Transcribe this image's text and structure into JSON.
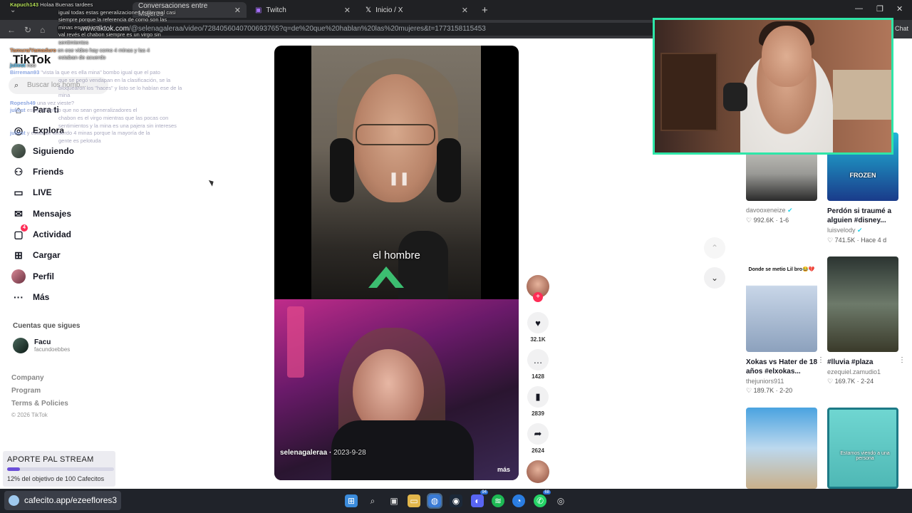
{
  "browser": {
    "tabs": [
      {
        "label": "Conversaciones entre Mujeres"
      },
      {
        "label": "Twitch"
      },
      {
        "label": "Inicio / X"
      }
    ],
    "url_domain": "www.tiktok.com",
    "url_path": "/@selenagaleraa/video/7284056040700693765?q=de%20que%20hablan%20las%20mujeres&t=1773158115453"
  },
  "sidebar": {
    "logo": "TikTok",
    "search_placeholder": "Buscar los homb...",
    "nav": [
      {
        "label": "Para ti",
        "icon": "home-icon"
      },
      {
        "label": "Explora",
        "icon": "compass-icon"
      },
      {
        "label": "Siguiendo",
        "icon": "following-avatar"
      },
      {
        "label": "Friends",
        "icon": "friends-icon"
      },
      {
        "label": "LIVE",
        "icon": "live-icon"
      },
      {
        "label": "Mensajes",
        "icon": "messages-icon"
      },
      {
        "label": "Actividad",
        "icon": "activity-icon",
        "badge": "4"
      },
      {
        "label": "Cargar",
        "icon": "upload-icon"
      },
      {
        "label": "Perfil",
        "icon": "profile-avatar"
      },
      {
        "label": "Más",
        "icon": "more-icon"
      }
    ],
    "following_title": "Cuentas que sigues",
    "following": [
      {
        "name": "Facu",
        "handle": "facundoebbes"
      }
    ],
    "footer": [
      "Company",
      "Program",
      "Terms & Policies"
    ],
    "copyright": "© 2026 TikTok"
  },
  "chat": [
    {
      "user": "Kapuch143",
      "text": "Holaa Buenas tardees"
    },
    {
      "user": "",
      "text": "igual todas estas generalizaciones están mal casi"
    },
    {
      "user": "",
      "text": "siempre porque la referencia de como son las"
    },
    {
      "user": "",
      "text": "minas es noti jota"
    },
    {
      "user": "",
      "text": "val revés el chabon siempre es un virgo sin"
    },
    {
      "user": "",
      "text": "sentimientos"
    },
    {
      "user": "Tamura/Yamaduro",
      "text": "en ese video hay como 4 minas y las 4"
    },
    {
      "user": "",
      "text": "estaban de acuerdo"
    },
    {
      "user": "juliest",
      "text": "noo"
    },
    {
      "user": "Birreman93",
      "text": "\"vista la que es ella mina\" bombo igual que el pato"
    },
    {
      "user": "",
      "text": "que se pegó vendapan en la clasificación, se la"
    },
    {
      "user": "",
      "text": "bloquearon los \"haces\" y listo se lo habían ese de la"
    },
    {
      "user": "",
      "text": "mina"
    },
    {
      "user": "Ropesh49",
      "text": "una vez vieste?"
    },
    {
      "user": "juliest",
      "text": "estoy diciendo que no sean generalizadores el"
    },
    {
      "user": "",
      "text": "chabon es el virgo mientras que las pocas con"
    },
    {
      "user": "",
      "text": "sentimientos y la mina es una pajera sin intereses"
    },
    {
      "user": "juliest",
      "text": "y estas de acuerdo 4 minas porque la mayoría de la"
    },
    {
      "user": "",
      "text": "gente es pelotuda"
    }
  ],
  "video": {
    "subtitle": "el hombre",
    "author": "selenagaleraa",
    "date": "2023-9-28",
    "more": "más"
  },
  "actions": {
    "likes": "32.1K",
    "comments": "1428",
    "saves": "2839",
    "shares": "2624"
  },
  "grid": [
    {
      "title": "",
      "user": "davooxeneize",
      "verified": true,
      "views": "992.6K",
      "date": "1-6"
    },
    {
      "title": "Perdón si traumé a alguien #disney...",
      "user": "luisvelody",
      "verified": true,
      "views": "741.5K",
      "date": "Hace 4 d",
      "thumb_text": "FROZEN"
    },
    {
      "title": "Xokas vs Hater de 18 años #elxokas...",
      "user": "thejuniors911",
      "verified": false,
      "views": "189.7K",
      "date": "2-20",
      "thumb_text": "Donde se metio Lil bro😂💔"
    },
    {
      "title": "#lluvia #plaza",
      "user": "ezequiel.zamudio1",
      "verified": false,
      "views": "169.7K",
      "date": "2-24"
    },
    {
      "title": "",
      "user": "",
      "verified": false,
      "views": "",
      "date": ""
    },
    {
      "title": "",
      "user": "",
      "verified": false,
      "views": "",
      "date": "",
      "thumb_text": "Estamos viendo a una persona"
    }
  ],
  "donation": {
    "title": "APORTE PAL STREAM",
    "progress": 0.12,
    "status": "12% del objetivo de 100 Cafecitos"
  },
  "taskbar": {
    "cafecito": "cafecito.app/ezeeflores3",
    "badge_discord": "94",
    "badge_whatsapp": "68"
  },
  "colors": {
    "accent": "#fe2c55",
    "webcam_border": "#2ee6a8",
    "progress": "#6b4fd8"
  }
}
